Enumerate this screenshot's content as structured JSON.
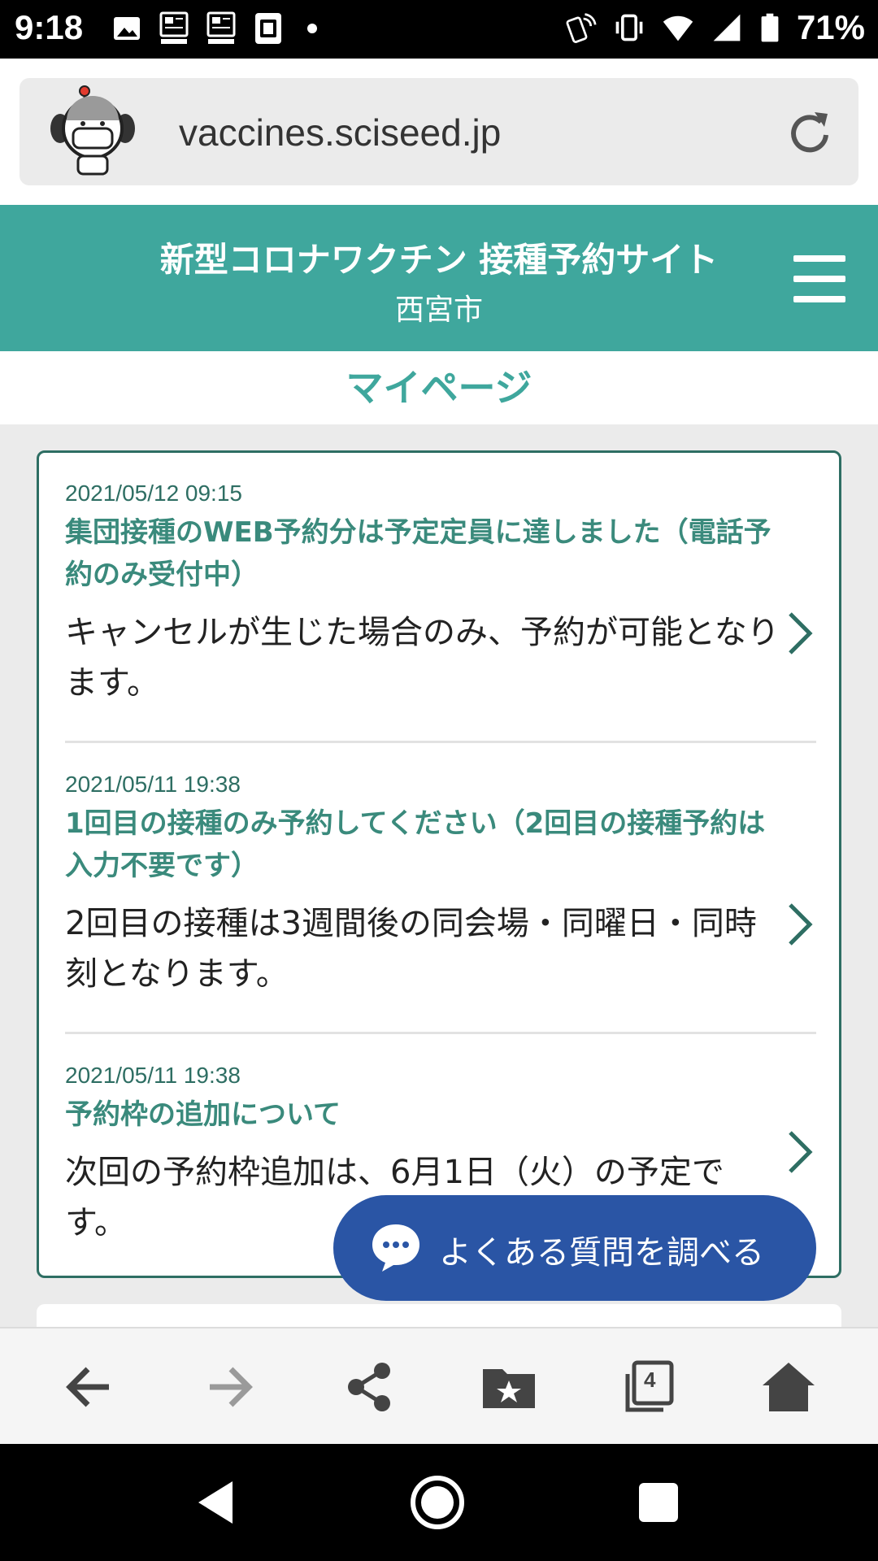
{
  "status_bar": {
    "time": "9:18",
    "battery": "71%",
    "left_icons": [
      "image-icon",
      "dmenu-news-icon",
      "dmenu-news-icon",
      "lawson-station-icon"
    ],
    "right_icons": [
      "nfc-icon",
      "vibrate-icon",
      "wifi-icon",
      "cell-signal-icon",
      "battery-icon"
    ]
  },
  "browser": {
    "url": "vaccines.sciseed.jp"
  },
  "site": {
    "title": "新型コロナワクチン 接種予約サイト",
    "city": "西宮市"
  },
  "page": {
    "title": "マイページ"
  },
  "news": [
    {
      "date": "2021/05/12 09:15",
      "title": "集団接種のWEB予約分は予定定員に達しました（電話予約のみ受付中）",
      "body": "キャンセルが生じた場合のみ、予約が可能となります。"
    },
    {
      "date": "2021/05/11 19:38",
      "title": "1回目の接種のみ予約してください（2回目の接種予約は入力不要です）",
      "body": "2回目の接種は3週間後の同会場・同曜日・同時刻となります。"
    },
    {
      "date": "2021/05/11 19:38",
      "title": "予約枠の追加について",
      "body": "次回の予約枠追加は、6月1日（火）の予定です。"
    }
  ],
  "faq_button": {
    "label": "よくある質問を調べる"
  },
  "toolbar": {
    "tab_count": "4"
  },
  "colors": {
    "brand_teal": "#3fa79d",
    "dark_teal": "#2e6e63",
    "faq_blue": "#2a55a5"
  }
}
